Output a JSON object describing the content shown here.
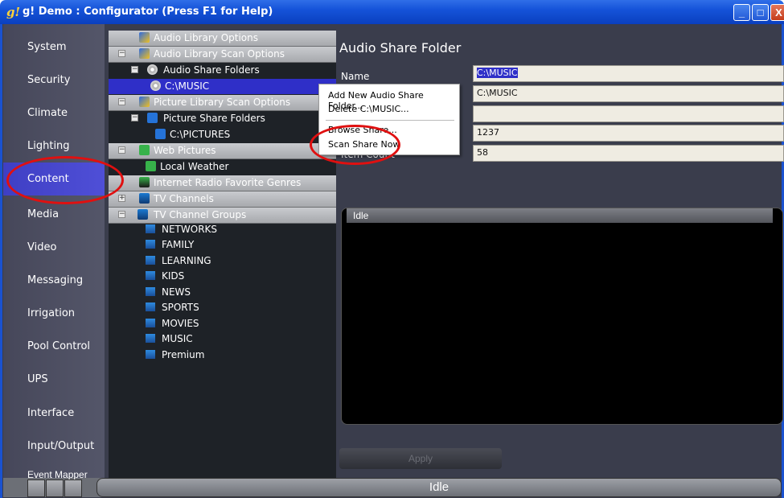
{
  "window": {
    "app_icon": "g!",
    "title": "g! Demo : Configurator   (Press F1 for Help)",
    "minimize": "_",
    "maximize": "□",
    "close": "X"
  },
  "sidebar": {
    "items": [
      {
        "label": "System"
      },
      {
        "label": "Security"
      },
      {
        "label": "Climate"
      },
      {
        "label": "Lighting"
      },
      {
        "label": "Content"
      },
      {
        "label": "Media"
      },
      {
        "label": "Video"
      },
      {
        "label": "Messaging"
      },
      {
        "label": "Irrigation"
      },
      {
        "label": "Pool Control"
      },
      {
        "label": "UPS"
      },
      {
        "label": "Interface"
      },
      {
        "label": "Input/Output"
      },
      {
        "label": "Event Mapper"
      }
    ],
    "selected": "Content"
  },
  "tree": {
    "audio_library_options": "Audio Library Options",
    "audio_library_scan_options": "Audio Library Scan Options",
    "audio_share_folders": "Audio Share Folders",
    "c_music": "C:\\MUSIC",
    "picture_library_scan_options": "Picture Library Scan Options",
    "picture_share_folders": "Picture Share Folders",
    "c_pictures": "C:\\PICTURES",
    "web_pictures": "Web Pictures",
    "local_weather": "Local Weather",
    "internet_radio_favorite_genres": "Internet Radio Favorite Genres",
    "tv_channels": "TV Channels",
    "tv_channel_groups": "TV Channel Groups",
    "groups": [
      "NETWORKS",
      "FAMILY",
      "LEARNING",
      "KIDS",
      "NEWS",
      "SPORTS",
      "MOVIES",
      "MUSIC",
      "Premium"
    ]
  },
  "context_menu": {
    "add": "Add New Audio Share Folder...",
    "delete": "Delete C:\\MUSIC...",
    "browse": "Browse Share...",
    "scan": "Scan Share Now"
  },
  "detail": {
    "title": "Audio Share Folder",
    "name_label": "Name",
    "item_count_label": "Item Count",
    "fields": [
      "C:\\MUSIC",
      "C:\\MUSIC",
      "",
      "1237",
      "58"
    ]
  },
  "log": {
    "header": "Idle"
  },
  "apply_label": "Apply",
  "status": "Idle",
  "colors": {
    "highlight": "#e01010",
    "selection": "#2f2fc8"
  }
}
